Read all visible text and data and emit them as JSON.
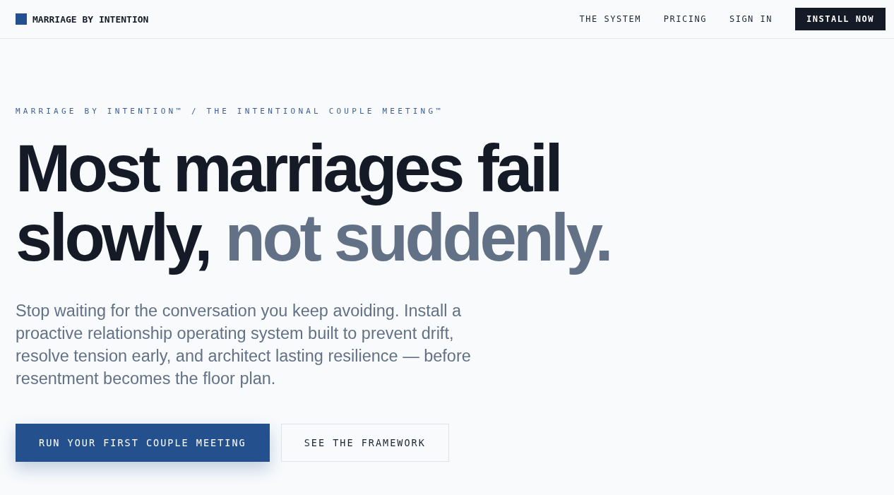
{
  "nav": {
    "brand": "MARRIAGE BY INTENTION",
    "links": [
      "THE SYSTEM",
      "PRICING",
      "SIGN IN"
    ],
    "cta": "INSTALL NOW"
  },
  "hero": {
    "eyebrow": "MARRIAGE BY INTENTION™ / THE INTENTIONAL COUPLE MEETING™",
    "headline_lines": [
      [
        {
          "text": "Most marriages fail",
          "muted": false
        }
      ],
      [
        {
          "text": "slowly,",
          "muted": false
        },
        {
          "text": "not suddenly.",
          "muted": true
        }
      ]
    ],
    "body": "Stop waiting for the conversation you keep avoiding. Install a proactive relationship operating system built to prevent drift, resolve tension early, and architect lasting resilience — before resentment becomes the floor plan.",
    "buttons": [
      {
        "label": "RUN YOUR FIRST COUPLE MEETING",
        "kind": "primary"
      },
      {
        "label": "SEE THE FRAMEWORK",
        "kind": "secondary"
      }
    ]
  }
}
